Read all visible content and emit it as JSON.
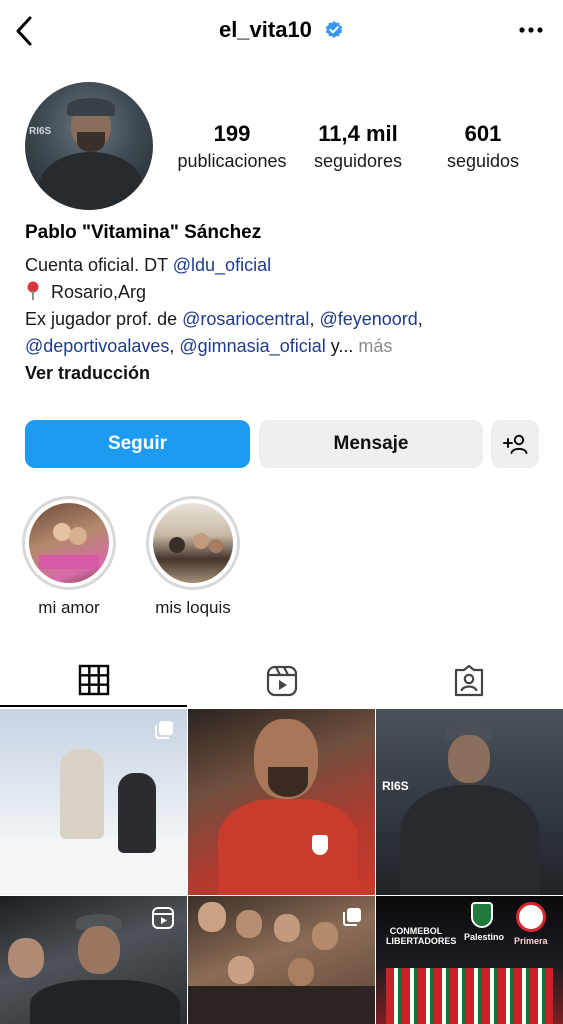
{
  "header": {
    "username": "el_vita10",
    "back_icon": "chevron-left-icon",
    "verified_icon": "verified-badge-icon",
    "menu_icon": "more-horizontal-icon"
  },
  "profile": {
    "avatar_tag": "RI6S",
    "stats": [
      {
        "value": "199",
        "label": "publicaciones"
      },
      {
        "value": "11,4 mil",
        "label": "seguidores"
      },
      {
        "value": "601",
        "label": "seguidos"
      }
    ],
    "name": "Pablo \"Vitamina\" Sánchez",
    "bio": {
      "line1_text": "Cuenta oficial. DT ",
      "line1_mention": "@ldu_oficial",
      "line2_text": "Rosario,Arg",
      "line3_text": "Ex jugador prof. de ",
      "line3_mention1": "@rosariocentral",
      "line3_sep": ", ",
      "line3_mention2": "@feyenoord",
      "line3_end": ",",
      "line4_mention1": "@deportivoalaves",
      "line4_sep": ", ",
      "line4_mention2": "@gimnasia_oficial",
      "line4_ellipsis": " y... ",
      "line4_more": "más",
      "translate": "Ver traducción"
    }
  },
  "actions": {
    "follow_label": "Seguir",
    "message_label": "Mensaje",
    "add_user_icon": "add-person-icon"
  },
  "highlights": [
    {
      "label": "mi amor"
    },
    {
      "label": "mis loquis"
    }
  ],
  "tabs": [
    {
      "name": "posts-grid-icon",
      "active": true
    },
    {
      "name": "reels-icon",
      "active": false
    },
    {
      "name": "tagged-icon",
      "active": false
    }
  ],
  "posts": {
    "badge_multi": "multiple-photos-icon",
    "badge_reel": "reel-icon",
    "c3_tag": "RI6S",
    "c6_top_left": "CONMEBOL LIBERTADORES",
    "c6_top_mid": "Palestino",
    "c6_top_right": "Primera"
  },
  "colors": {
    "accent": "#1c9bf0",
    "mention": "#1f3b8f",
    "secondary_button": "#efefef",
    "verified": "#3897f0"
  }
}
